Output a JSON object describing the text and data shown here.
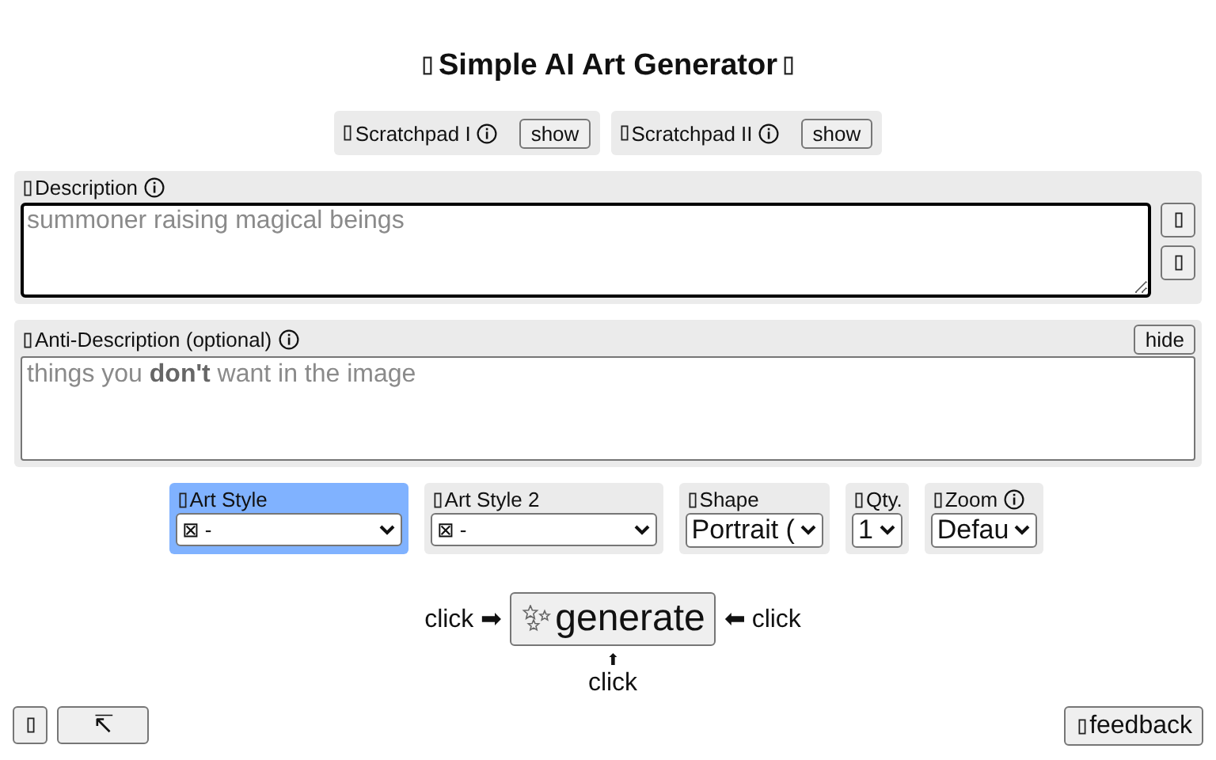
{
  "title": "Simple AI Art Generator",
  "scratchpads": [
    {
      "label": "Scratchpad I",
      "button": "show"
    },
    {
      "label": "Scratchpad II",
      "button": "show"
    }
  ],
  "description": {
    "label": "Description",
    "placeholder": "summoner raising magical beings"
  },
  "anti_description": {
    "label": "Anti-Description (optional)",
    "button": "hide",
    "placeholder": "things you **don't** want in the image"
  },
  "options": [
    {
      "label": "Art Style",
      "value": "⊠ -",
      "selected": true,
      "info": false
    },
    {
      "label": "Art Style 2",
      "value": "⊠ -",
      "selected": false,
      "info": false
    },
    {
      "label": "Shape",
      "value": "Portrait (",
      "selected": false,
      "info": false
    },
    {
      "label": "Qty.",
      "value": "1",
      "selected": false,
      "info": false
    },
    {
      "label": "Zoom",
      "value": "Defau",
      "selected": false,
      "info": true
    }
  ],
  "generate": {
    "left_hint": "click ➡",
    "button": "generate",
    "right_hint": "⬅ click",
    "up_arrow": "⬆",
    "bottom_hint": "click"
  },
  "footer": {
    "corner_button": "↸",
    "feedback": "feedback"
  }
}
